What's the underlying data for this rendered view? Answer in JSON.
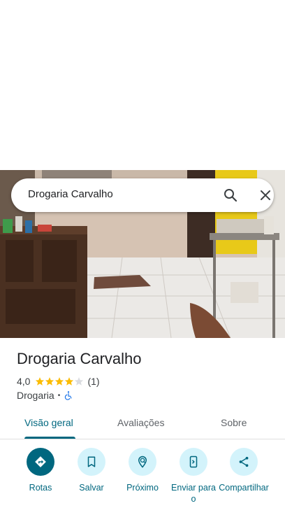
{
  "search": {
    "query": "Drogaria Carvalho"
  },
  "place": {
    "name": "Drogaria Carvalho",
    "rating": "4,0",
    "stars_filled": 4,
    "stars_total": 5,
    "review_count": "(1)",
    "category": "Drogaria",
    "separator": "•",
    "accessibility_icon": "wheelchair-icon"
  },
  "tabs": [
    {
      "label": "Visão geral",
      "active": true
    },
    {
      "label": "Avaliações",
      "active": false
    },
    {
      "label": "Sobre",
      "active": false
    }
  ],
  "actions": [
    {
      "label": "Rotas",
      "icon": "directions-icon"
    },
    {
      "label": "Salvar",
      "icon": "bookmark-icon"
    },
    {
      "label": "Próximo",
      "icon": "nearby-icon"
    },
    {
      "label": "Enviar para o",
      "icon": "send-to-phone-icon"
    },
    {
      "label": "Compartilhar",
      "icon": "share-icon"
    }
  ],
  "colors": {
    "accent": "#00677f",
    "action_bg": "#d3f3fb",
    "star": "#fbbc04",
    "wheelchair": "#1a73e8"
  }
}
